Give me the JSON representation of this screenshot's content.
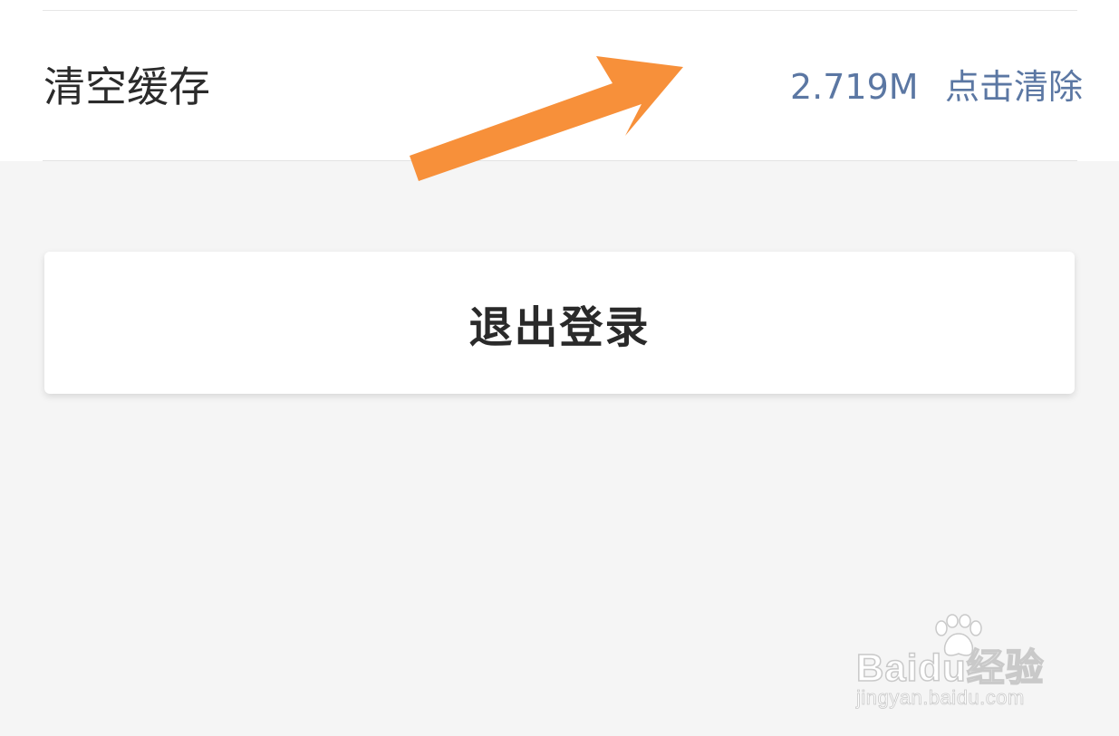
{
  "settings": {
    "clear_cache": {
      "label": "清空缓存",
      "cache_size": "2.719M",
      "action_label": "点击清除"
    }
  },
  "logout": {
    "label": "退出登录"
  },
  "annotation": {
    "arrow_color": "#f7903a"
  },
  "watermark": {
    "brand": "Baidu经验",
    "url": "jingyan.baidu.com"
  },
  "colors": {
    "link": "#5b77a3",
    "text": "#2b2b2b",
    "background": "#f5f5f5",
    "panel": "#ffffff"
  }
}
